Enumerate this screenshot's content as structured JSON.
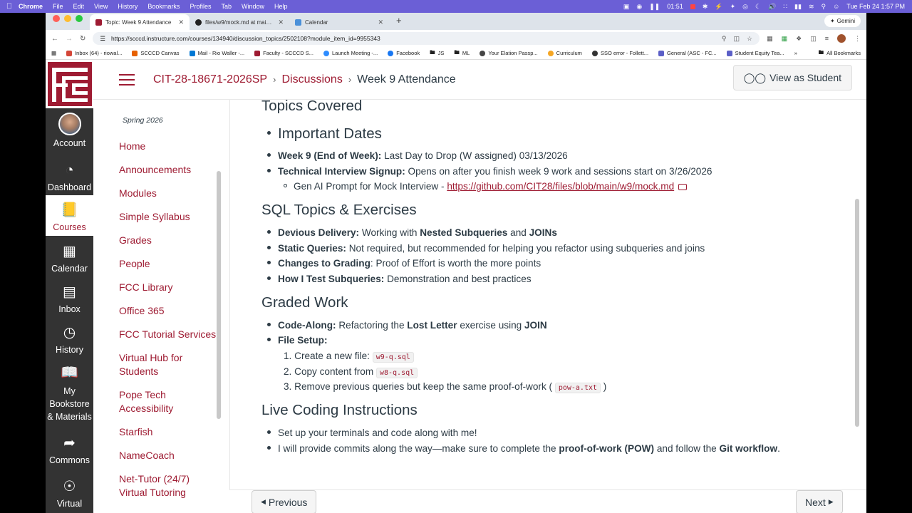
{
  "menubar": {
    "app": "Chrome",
    "menus": [
      "File",
      "Edit",
      "View",
      "History",
      "Bookmarks",
      "Profiles",
      "Tab",
      "Window",
      "Help"
    ],
    "timer": "01:51",
    "clock": "Tue Feb 24  1:57 PM"
  },
  "tabs": [
    {
      "title": "Topic: Week 9 Attendance",
      "color": "#9e1b32"
    },
    {
      "title": "files/w9/mock.md at main · C",
      "color": "#222222"
    },
    {
      "title": "Calendar",
      "color": "#4a90d9"
    }
  ],
  "gemini_label": "Gemini",
  "url": "https://scccd.instructure.com/courses/134940/discussion_topics/2502108?module_item_id=9955343",
  "bookmarks": [
    {
      "label": "Inbox (64) - riowal...",
      "color": "#d44638"
    },
    {
      "label": "SCCCD Canvas",
      "color": "#e66000"
    },
    {
      "label": "Mail - Rio Waller -...",
      "color": "#0078d4"
    },
    {
      "label": "Faculty - SCCCD S...",
      "color": "#9e1b32"
    },
    {
      "label": "Launch Meeting -...",
      "color": "#2d8cff"
    },
    {
      "label": "Facebook",
      "color": "#1877f2"
    },
    {
      "label": "JS",
      "color": "#666666"
    },
    {
      "label": "ML",
      "color": "#666666"
    },
    {
      "label": "Your Elation Passp...",
      "color": "#444444"
    },
    {
      "label": "Curriculum",
      "color": "#f5a623"
    },
    {
      "label": "SSO error - Follett...",
      "color": "#333333"
    },
    {
      "label": "General (ASC - FC...",
      "color": "#5b5fc7"
    },
    {
      "label": "Student Equity Tea...",
      "color": "#5b5fc7"
    }
  ],
  "all_bookmarks": "All Bookmarks",
  "global_nav": [
    {
      "label": "Account",
      "icon": "avatar"
    },
    {
      "label": "Dashboard",
      "icon": "dashboard-icon"
    },
    {
      "label": "Courses",
      "icon": "book-icon"
    },
    {
      "label": "Calendar",
      "icon": "calendar-icon"
    },
    {
      "label": "Inbox",
      "icon": "inbox-icon"
    },
    {
      "label": "History",
      "icon": "clock-icon"
    },
    {
      "label": "My Bookstore & Materials",
      "icon": "bookstore-icon"
    },
    {
      "label": "Commons",
      "icon": "commons-icon"
    },
    {
      "label": "Virtual",
      "icon": "virtual-icon"
    }
  ],
  "breadcrumb": [
    "CIT-28-18671-2026SP",
    "Discussions",
    "Week 9 Attendance"
  ],
  "view_as_student": "View as Student",
  "course_nav": {
    "term": "Spring 2026",
    "items": [
      "Home",
      "Announcements",
      "Modules",
      "Simple Syllabus",
      "Grades",
      "People",
      "FCC Library",
      "Office 365",
      "FCC Tutorial Services",
      "Virtual Hub for Students",
      "Pope Tech Accessibility",
      "Starfish",
      "NameCoach",
      "Net-Tutor (24/7) Virtual Tutoring"
    ]
  },
  "content": {
    "topics_heading": "Topics Covered",
    "important_dates": "Important Dates",
    "week9_label": "Week 9 (End of Week):",
    "week9_text": " Last Day to Drop (W assigned) 03/13/2026",
    "signup_label": "Technical Interview Signup:",
    "signup_text": " Opens on after you finish week 9 work and sessions start on 3/26/2026",
    "genai_text": "Gen AI Prompt for Mock Interview - ",
    "genai_link": "https://github.com/CIT28/files/blob/main/w9/mock.md",
    "sql_heading": "SQL Topics & Exercises",
    "devious_label": "Devious Delivery:",
    "devious_text1": " Working with ",
    "devious_b1": "Nested Subqueries",
    "devious_text2": " and ",
    "devious_b2": "JOINs",
    "static_label": "Static Queries:",
    "static_text": " Not required, but recommended for helping you refactor using subqueries and joins",
    "changes_label": "Changes to Grading",
    "changes_text": ": Proof of Effort is worth the more points",
    "howi_label": "How I Test Subqueries:",
    "howi_text": " Demonstration and best practices",
    "graded_heading": "Graded Work",
    "codealong_label": "Code-Along:",
    "codealong_text1": " Refactoring the ",
    "codealong_b1": "Lost Letter",
    "codealong_text2": " exercise using ",
    "codealong_b2": "JOIN",
    "filesetup_label": "File Setup:",
    "step1_num": "1.",
    "step1_text": "Create a new file: ",
    "step1_code": "w9-q.sql",
    "step2_num": "2.",
    "step2_text": "Copy content from ",
    "step2_code": "w8-q.sql",
    "step3_num": "3.",
    "step3_text": "Remove previous queries but keep the same proof-of-work (",
    "step3_code": "pow-a.txt",
    "step3_end": ")",
    "live_heading": "Live Coding Instructions",
    "live1": "Set up your terminals and code along with me!",
    "live2_text1": "I will provide commits along the way—make sure to complete the ",
    "live2_b1": "proof-of-work (POW)",
    "live2_text2": " and follow the ",
    "live2_b2": "Git workflow",
    "live2_end": "."
  },
  "prev_label": "Previous",
  "next_label": "Next",
  "colors": {
    "brand": "#9e1b32",
    "nav_bg": "#333333",
    "menubar": "#6b5fd6"
  }
}
